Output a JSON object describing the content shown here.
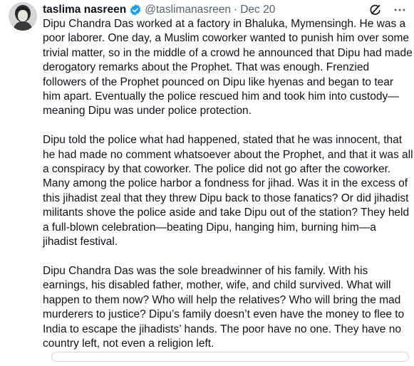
{
  "tweet": {
    "author_name": "taslima nasreen",
    "handle": "@taslimanasreen",
    "separator": "·",
    "date": "Dec 20",
    "verified_icon": "verified-badge-icon",
    "paragraphs": [
      "Dipu Chandra Das worked at a factory in Bhaluka, Mymensingh. He was a poor laborer. One day, a Muslim coworker wanted to punish him over some trivial matter, so in the middle of a crowd he announced that Dipu had made derogatory remarks about the Prophet. That was enough. Frenzied followers of the Prophet pounced on Dipu like hyenas and began to tear him apart. Eventually the police rescued him and took him into custody—meaning Dipu was under police protection.",
      "Dipu told the police what had happened, stated that he was innocent, that he had made no comment whatsoever about the Prophet, and that it was all a conspiracy by that coworker. The police did not go after the coworker. Many among the police harbor a fondness for jihad. Was it in the excess of this jihadist zeal that they threw Dipu back to those fanatics? Or did jihadist militants shove the police aside and take Dipu out of the station? They held a full-blown celebration—beating Dipu, hanging him, burning him—a jihadist festival.",
      "Dipu Chandra Das was the sole breadwinner of his family. With his earnings, his disabled father, mother, wife, and child survived. What will happen to them now? Who will help the relatives? Who will bring the mad murderers to justice? Dipu’s family doesn’t even have the money to flee to India to escape the jihadists’ hands. The poor have no one. They have no country left, not even a religion left."
    ]
  },
  "icons": {
    "grok": "grok-icon",
    "more": "more-options-icon",
    "avatar": "avatar"
  },
  "colors": {
    "text": "#0f1419",
    "secondary": "#536471",
    "verified_blue": "#1d9bf0",
    "border": "#cfd9de"
  }
}
